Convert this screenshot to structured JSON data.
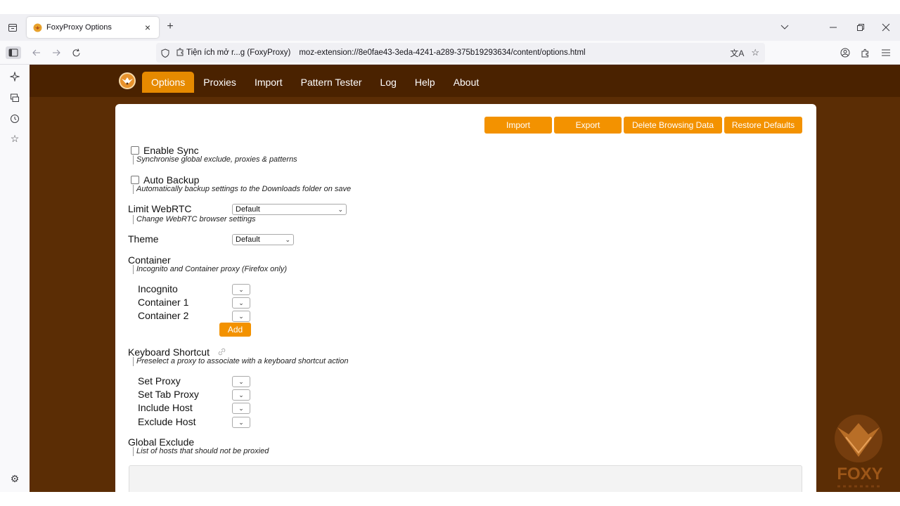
{
  "browser": {
    "tab": {
      "title": "FoxyProxy Options",
      "close": "×"
    },
    "new_tab": "+",
    "url_chip": "Tiện ích mở r...g (FoxyProxy)",
    "url": "moz-extension://8e0fae43-3eda-4241-a289-375b19293634/content/options.html"
  },
  "nav": {
    "items": [
      "Options",
      "Proxies",
      "Import",
      "Pattern Tester",
      "Log",
      "Help",
      "About"
    ],
    "active": "Options"
  },
  "actions": {
    "import": "Import",
    "export": "Export",
    "delete_browsing": "Delete Browsing Data",
    "restore_defaults": "Restore Defaults"
  },
  "options": {
    "sync": {
      "label": "Enable Sync",
      "desc": "Synchronise global exclude, proxies & patterns",
      "checked": false
    },
    "backup": {
      "label": "Auto Backup",
      "desc": "Automatically backup settings to the Downloads folder on save",
      "checked": false
    },
    "webrtc": {
      "label": "Limit WebRTC",
      "value": "Default",
      "desc": "Change WebRTC browser settings"
    },
    "theme": {
      "label": "Theme",
      "value": "Default"
    },
    "container": {
      "label": "Container",
      "desc": "Incognito and Container proxy (Firefox only)",
      "items": [
        "Incognito",
        "Container 1",
        "Container 2"
      ],
      "add": "Add"
    },
    "shortcut": {
      "label": "Keyboard Shortcut",
      "desc": "Preselect a proxy to associate with a keyboard shortcut action",
      "items": [
        "Set Proxy",
        "Set Tab Proxy",
        "Include Host",
        "Exclude Host"
      ]
    },
    "exclude": {
      "label": "Global Exclude",
      "desc": "List of hosts that should not be proxied"
    }
  },
  "brand": {
    "text": "FOXY"
  },
  "colors": {
    "accent": "#f39200",
    "header": "#4a2200",
    "page_bg": "#5b2d05",
    "active_tab": "#e68a00"
  }
}
